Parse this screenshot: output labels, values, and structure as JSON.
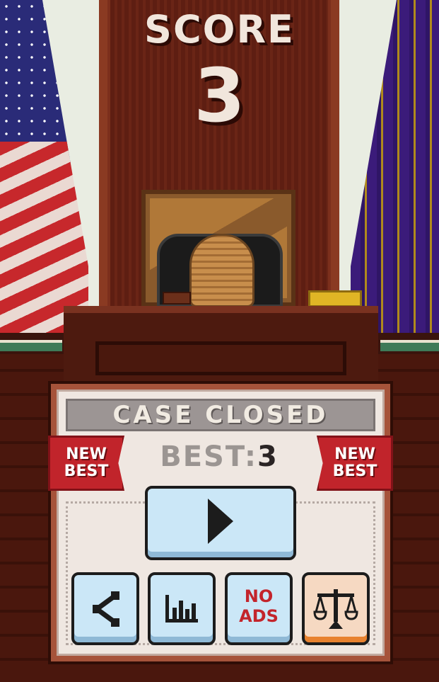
{
  "hud": {
    "score_label": "SCORE",
    "score_value": "3"
  },
  "panel": {
    "title": "CASE CLOSED",
    "best_label": "BEST:",
    "best_value": "3",
    "ribbon_left": [
      "NEW",
      "BEST"
    ],
    "ribbon_right": [
      "NEW",
      "BEST"
    ]
  },
  "buttons": {
    "play": {
      "icon": "play-icon"
    },
    "share": {
      "icon": "share-icon"
    },
    "leaderboard": {
      "icon": "bar-chart-icon"
    },
    "no_ads": {
      "line1": "NO",
      "line2": "ADS"
    },
    "justice": {
      "icon": "scales-icon"
    }
  },
  "colors": {
    "ribbon": "#c1242b",
    "button": "#cbe7f7",
    "accent_orange": "#e8822f"
  }
}
